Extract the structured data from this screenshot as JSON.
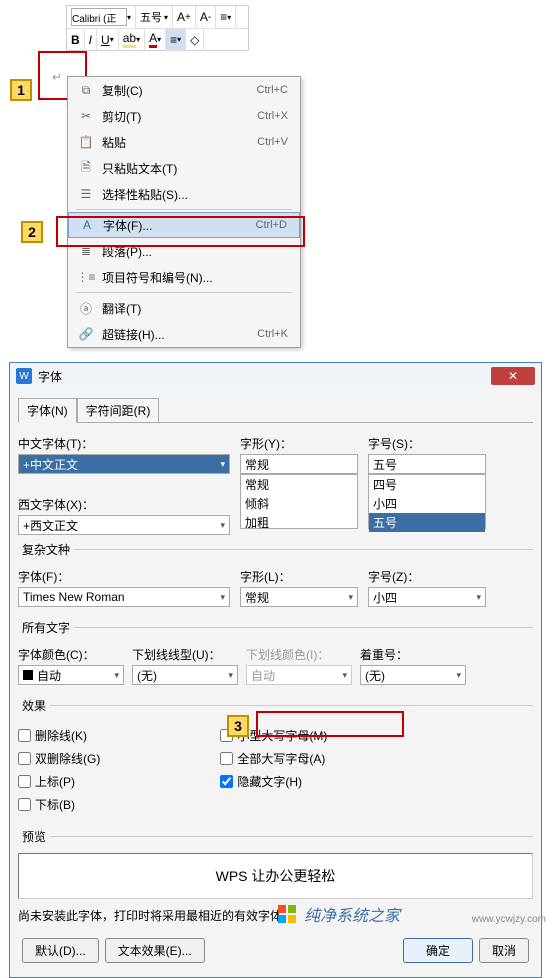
{
  "toolbar": {
    "font_name": "Calibri (正",
    "font_size": "五号"
  },
  "callouts": {
    "c1": "1",
    "c2": "2",
    "c3": "3"
  },
  "menu": {
    "copy": {
      "label": "复制(C)",
      "shortcut": "Ctrl+C"
    },
    "cut": {
      "label": "剪切(T)",
      "shortcut": "Ctrl+X"
    },
    "paste": {
      "label": "粘贴",
      "shortcut": "Ctrl+V"
    },
    "paste_text": {
      "label": "只粘贴文本(T)"
    },
    "paste_special": {
      "label": "选择性粘贴(S)..."
    },
    "font": {
      "label": "字体(F)...",
      "shortcut": "Ctrl+D"
    },
    "paragraph": {
      "label": "段落(P)..."
    },
    "bullets": {
      "label": "项目符号和编号(N)..."
    },
    "translate": {
      "label": "翻译(T)"
    },
    "hyperlink": {
      "label": "超链接(H)...",
      "shortcut": "Ctrl+K"
    }
  },
  "dialog": {
    "title": "字体",
    "tabs": {
      "font": "字体(N)",
      "spacing": "字符间距(R)"
    },
    "cn_font_label": "中文字体(T)：",
    "cn_font_value": "+中文正文",
    "west_font_label": "西文字体(X)：",
    "west_font_value": "+西文正文",
    "style_label": "字形(Y)：",
    "style_value": "常规",
    "style_opts": [
      "常规",
      "倾斜",
      "加粗"
    ],
    "size_label": "字号(S)：",
    "size_value": "五号",
    "size_opts": [
      "四号",
      "小四",
      "五号"
    ],
    "complex_legend": "复杂文种",
    "complex_font_label": "字体(F)：",
    "complex_font_value": "Times New Roman",
    "complex_style_label": "字形(L)：",
    "complex_style_value": "常规",
    "complex_size_label": "字号(Z)：",
    "complex_size_value": "小四",
    "all_text_legend": "所有文字",
    "font_color_label": "字体颜色(C)：",
    "font_color_value": "自动",
    "underline_label": "下划线线型(U)：",
    "underline_value": "(无)",
    "underline_color_label": "下划线颜色(I)：",
    "underline_color_value": "自动",
    "emphasis_label": "着重号：",
    "emphasis_value": "(无)",
    "effects_legend": "效果",
    "strike": "删除线(K)",
    "dbl_strike": "双删除线(G)",
    "superscript": "上标(P)",
    "subscript": "下标(B)",
    "smallcaps": "小型大写字母(M)",
    "allcaps": "全部大写字母(A)",
    "hidden": "隐藏文字(H)",
    "preview_legend": "预览",
    "preview_text": "WPS 让办公更轻松",
    "note": "尚未安装此字体，打印时将采用最相近的有效字体。",
    "btn_default": "默认(D)...",
    "btn_text_effect": "文本效果(E)...",
    "btn_ok": "确定",
    "btn_cancel": "取消"
  },
  "footer": {
    "brand": "纯净系统之家",
    "url": "www.ycwjzy.com"
  }
}
